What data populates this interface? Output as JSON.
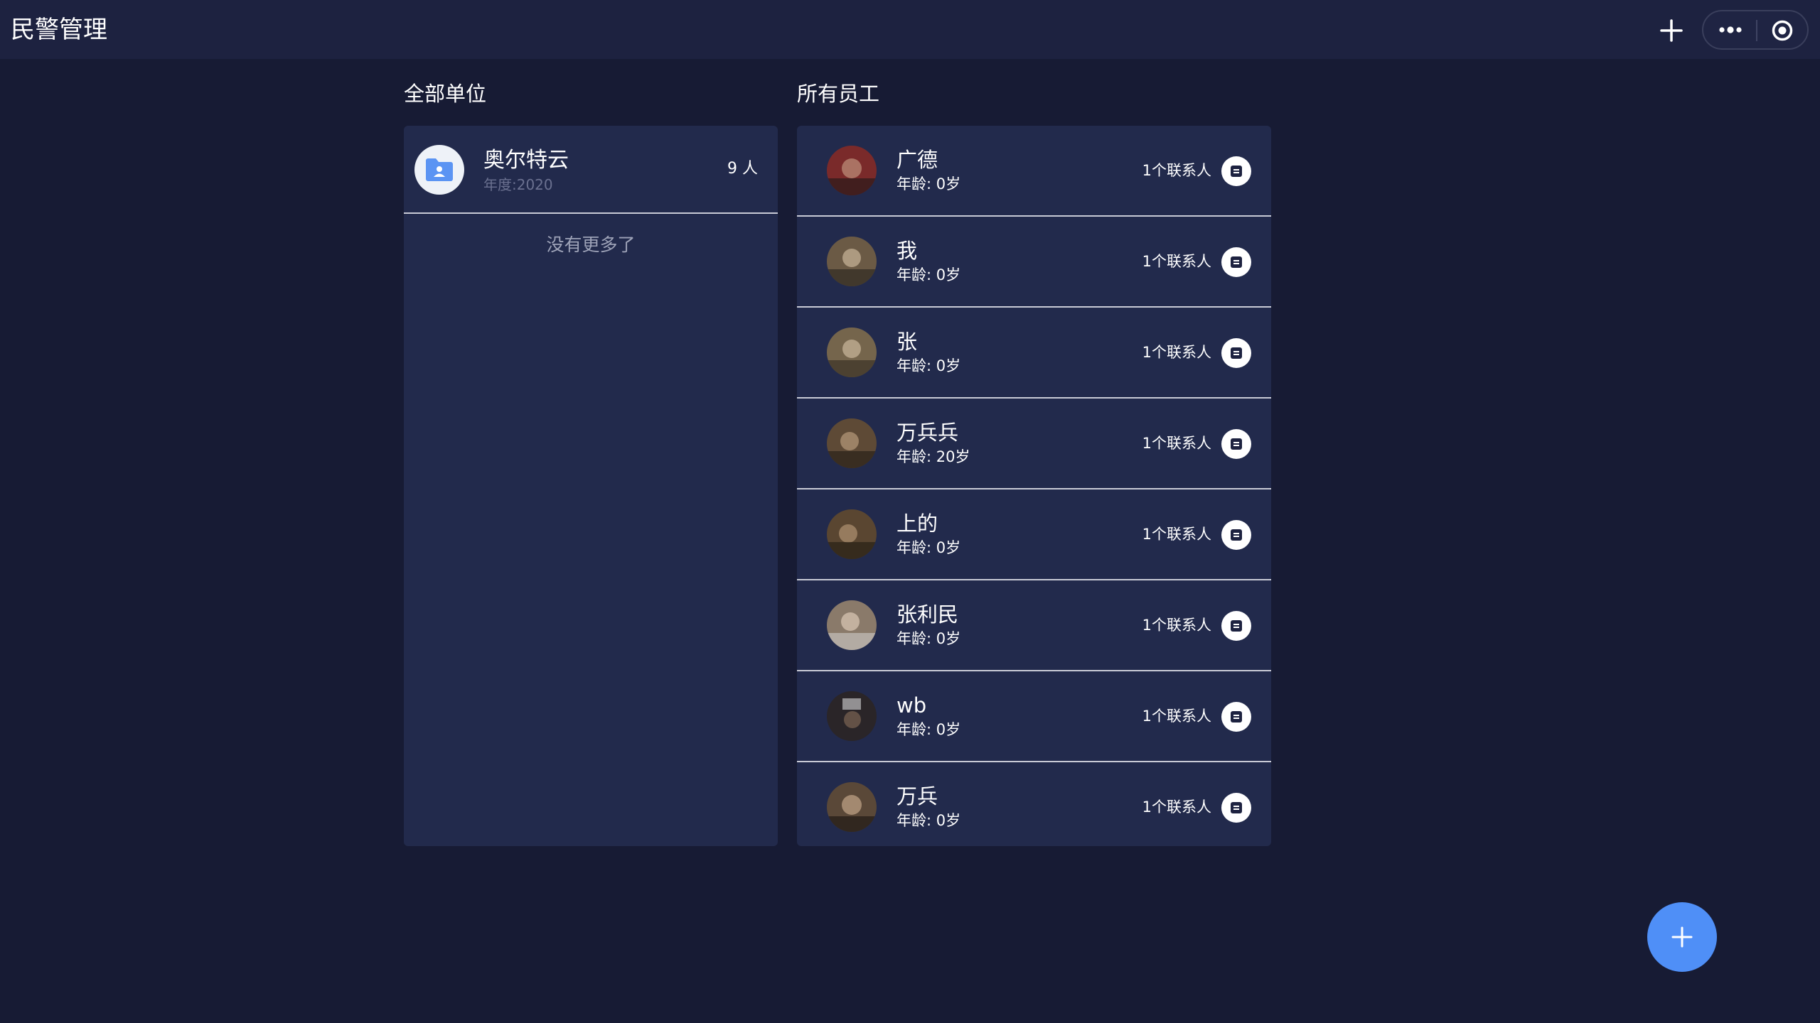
{
  "app": {
    "title": "民警管理"
  },
  "top_actions": {
    "add_icon": "plus-icon",
    "more_icon": "more-dots-icon",
    "target_icon": "target-icon"
  },
  "left_section": {
    "title": "全部单位",
    "units": [
      {
        "name": "奥尔特云",
        "year": "年度:2020",
        "count": "9 人",
        "icon": "folder-user-icon"
      }
    ],
    "no_more": "没有更多了"
  },
  "right_section": {
    "title": "所有员工",
    "employees": [
      {
        "name": "广德",
        "age": "年龄: 0岁",
        "contacts": "1个联系人",
        "avatar_color": "#7a2a2a"
      },
      {
        "name": "我",
        "age": "年龄: 0岁",
        "contacts": "1个联系人",
        "avatar_color": "#6b5a45"
      },
      {
        "name": "张",
        "age": "年龄: 0岁",
        "contacts": "1个联系人",
        "avatar_color": "#75654c"
      },
      {
        "name": "万兵兵",
        "age": "年龄: 20岁",
        "contacts": "1个联系人",
        "avatar_color": "#5e4a36"
      },
      {
        "name": "上的",
        "age": "年龄: 0岁",
        "contacts": "1个联系人",
        "avatar_color": "#5a4631"
      },
      {
        "name": "张利民",
        "age": "年龄: 0岁",
        "contacts": "1个联系人",
        "avatar_color": "#8a7a6a"
      },
      {
        "name": "wb",
        "age": "年龄: 0岁",
        "contacts": "1个联系人",
        "avatar_color": "#2a2528"
      },
      {
        "name": "万兵",
        "age": "年龄: 0岁",
        "contacts": "1个联系人",
        "avatar_color": "#5a4838"
      }
    ]
  },
  "fab": {
    "icon": "plus-icon",
    "color": "#4f8ff7"
  },
  "colors": {
    "background": "#171b34",
    "topbar": "#1d2240",
    "panel": "#222a4c",
    "accent": "#4f8ff7"
  }
}
